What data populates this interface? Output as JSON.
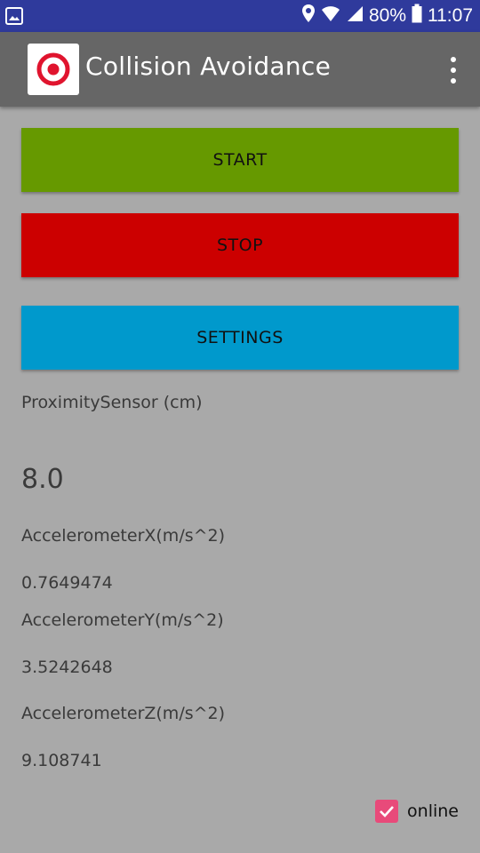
{
  "status_bar": {
    "battery_percent": "80%",
    "time": "11:07"
  },
  "app_bar": {
    "title": "Collision Avoidance"
  },
  "buttons": {
    "start": "START",
    "stop": "STOP",
    "settings": "SETTINGS"
  },
  "sensors": {
    "proximity_label": "ProximitySensor (cm)",
    "proximity_value": "8.0",
    "accel_x_label": "AccelerometerX(m/s^2)",
    "accel_x_value": "0.7649474",
    "accel_y_label": "AccelerometerY(m/s^2)",
    "accel_y_value": "3.5242648",
    "accel_z_label": "AccelerometerZ(m/s^2)",
    "accel_z_value": "9.108741"
  },
  "online": {
    "label": "online",
    "checked": true
  },
  "colors": {
    "status_bar": "#2f3a9c",
    "app_bar": "#666666",
    "background": "#a9a9a9",
    "start": "#669900",
    "stop": "#cc0000",
    "settings": "#0099cc",
    "checkbox": "#e84a7a"
  }
}
